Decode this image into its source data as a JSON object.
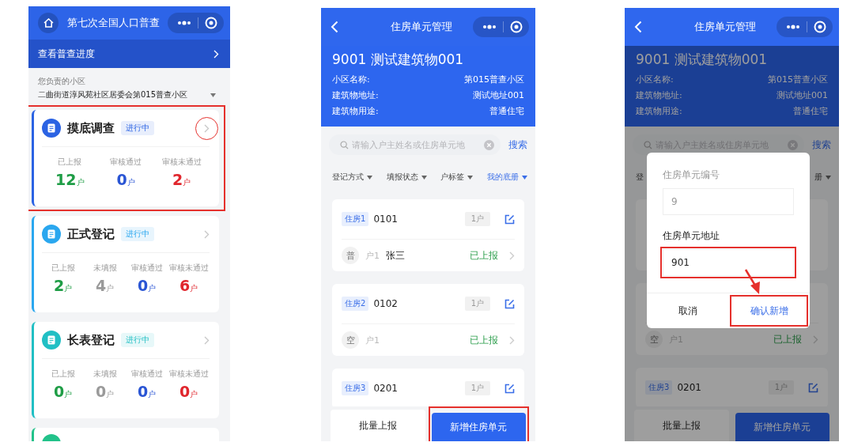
{
  "overview_screen": {
    "nav": {
      "title": "第七次全国人口普查"
    },
    "progress_link": "查看普查进度",
    "community": {
      "label": "您负责的小区",
      "value": "二曲街道淳风苑社区居委会第015普查小区"
    },
    "cards": [
      {
        "title": "摸底调查",
        "badge": "进行中",
        "color": "#2b63e3",
        "highlighted": true,
        "chevron_circled": true,
        "stats": [
          {
            "label": "已上报",
            "value": "12",
            "unit": "户",
            "kind": "reported"
          },
          {
            "label": "审核通过",
            "value": "0",
            "unit": "户",
            "kind": "approved"
          },
          {
            "label": "审核未通过",
            "value": "2",
            "unit": "户",
            "kind": "rejected"
          }
        ]
      },
      {
        "title": "正式登记",
        "badge": "进行中",
        "color": "#2aa7ef",
        "highlighted": false,
        "chevron_circled": false,
        "stats": [
          {
            "label": "已上报",
            "value": "2",
            "unit": "户",
            "kind": "reported"
          },
          {
            "label": "未填报",
            "value": "4",
            "unit": "户",
            "kind": "unfilled"
          },
          {
            "label": "审核通过",
            "value": "0",
            "unit": "户",
            "kind": "approved"
          },
          {
            "label": "审核未通过",
            "value": "6",
            "unit": "户",
            "kind": "rejected"
          }
        ]
      },
      {
        "title": "长表登记",
        "badge": "进行中",
        "color": "#21bfc4",
        "highlighted": false,
        "chevron_circled": false,
        "stats": [
          {
            "label": "已上报",
            "value": "0",
            "unit": "户",
            "kind": "reported"
          },
          {
            "label": "未填报",
            "value": "0",
            "unit": "户",
            "kind": "unfilled"
          },
          {
            "label": "审核通过",
            "value": "0",
            "unit": "户",
            "kind": "approved"
          },
          {
            "label": "审核未通过",
            "value": "0",
            "unit": "户",
            "kind": "rejected"
          }
        ]
      }
    ],
    "partial_card": {
      "color": "#22c28a"
    }
  },
  "unit_list_screen": {
    "nav": {
      "title": "住房单元管理"
    },
    "building": {
      "title": "9001 测试建筑物001",
      "fields": [
        {
          "label": "小区名称:",
          "value": "第015普查小区"
        },
        {
          "label": "建筑物地址:",
          "value": "测试地址001"
        },
        {
          "label": "建筑物用途:",
          "value": "普通住宅"
        }
      ]
    },
    "search": {
      "placeholder": "请输入户主姓名或住房单元地",
      "button": "搜索"
    },
    "filters": [
      {
        "label": "登记方式",
        "selected": false
      },
      {
        "label": "填报状态",
        "selected": false
      },
      {
        "label": "户标签",
        "selected": false
      },
      {
        "label": "我的底册",
        "selected": true
      }
    ],
    "units": [
      {
        "header_covered": false,
        "tag": "住房1",
        "number": "0101",
        "count": "1户",
        "households": [
          {
            "type": "普",
            "label": "户1",
            "name": "张三",
            "status": "已上报"
          }
        ]
      },
      {
        "header_covered": false,
        "tag": "住房2",
        "number": "0102",
        "count": "1户",
        "households": [
          {
            "type": "空",
            "label": "户1",
            "status": "已上报"
          }
        ]
      },
      {
        "header_covered": false,
        "tag": "住房3",
        "number": "0201",
        "count": "1户"
      }
    ],
    "actions": [
      {
        "label": "批量上报",
        "kind": "secondary",
        "highlighted": false
      },
      {
        "label": "新增住房单元",
        "kind": "primary",
        "highlighted": true
      }
    ]
  },
  "add_unit_screen": {
    "nav": {
      "title": "住房单元管理"
    },
    "building": {
      "title": "9001 测试建筑物001",
      "fields": [
        {
          "label": "小区名称:",
          "value": "第015普查小区"
        },
        {
          "label": "建筑物地址:",
          "value": "测试地址001"
        },
        {
          "label": "建筑物用途:",
          "value": "普通住宅"
        }
      ]
    },
    "search": {
      "placeholder": "请输入户主姓名或住房单元地",
      "button": "搜索"
    },
    "filter_fragments": {
      "left": "登",
      "right": "册"
    },
    "units": [
      {
        "header_covered": true,
        "households": [
          {
            "type": "空",
            "label": "户1",
            "status": "已上报"
          }
        ]
      },
      {
        "header_covered": false,
        "tag": "住房3",
        "number": "0201",
        "count": "1户"
      }
    ],
    "actions": [
      {
        "label": "批量上报",
        "kind": "secondary",
        "highlighted": false
      },
      {
        "label": "新增住房单元",
        "kind": "primary",
        "highlighted": false
      }
    ],
    "dialog": {
      "fields": [
        {
          "label": "住房单元编号",
          "value": "9",
          "disabled": true,
          "highlighted": false
        },
        {
          "label": "住房单元地址",
          "value": "901",
          "disabled": false,
          "highlighted": true
        }
      ],
      "cancel": "取消",
      "confirm": {
        "label": "确认新增",
        "highlighted": true
      },
      "pointer_arrow": true
    }
  }
}
